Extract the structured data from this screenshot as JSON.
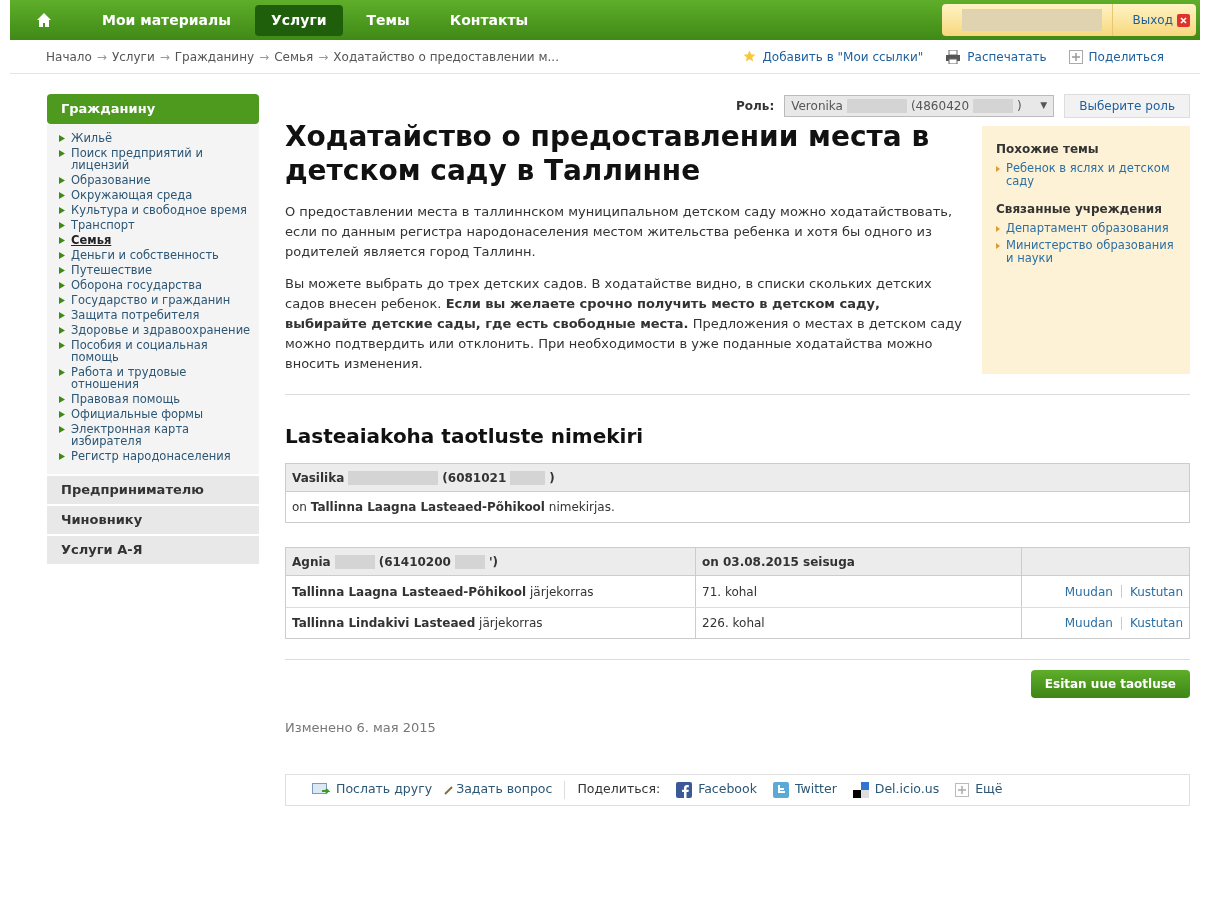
{
  "top_nav": {
    "items": [
      {
        "label": "Мои материалы",
        "selected": false
      },
      {
        "label": "Услуги",
        "selected": true
      },
      {
        "label": "Темы",
        "selected": false
      },
      {
        "label": "Контакты",
        "selected": false
      }
    ],
    "logout": "Выход"
  },
  "breadcrumb": {
    "items": [
      "Начало",
      "Услуги",
      "Гражданину",
      "Семья",
      "Ходатайство о предоставлении м..."
    ],
    "separator": "→",
    "actions": [
      {
        "kind": "star",
        "label": "Добавить в \"Мои ссылки\""
      },
      {
        "kind": "print",
        "label": "Распечатать"
      },
      {
        "kind": "share",
        "label": "Поделиться"
      }
    ]
  },
  "sidebar": {
    "title": "Гражданину",
    "items": [
      {
        "label": "Жильё",
        "selected": false
      },
      {
        "label": "Поиск предприятий и лицензий",
        "selected": false
      },
      {
        "label": "Образование",
        "selected": false
      },
      {
        "label": "Окружающая среда",
        "selected": false
      },
      {
        "label": "Культура и свободное время",
        "selected": false
      },
      {
        "label": "Транспорт",
        "selected": false
      },
      {
        "label": "Семья",
        "selected": true
      },
      {
        "label": "Деньги и собственность",
        "selected": false
      },
      {
        "label": "Путешествие",
        "selected": false
      },
      {
        "label": "Оборона государства",
        "selected": false
      },
      {
        "label": "Государство и гражданин",
        "selected": false
      },
      {
        "label": "Защита потребителя",
        "selected": false
      },
      {
        "label": "Здоровье и здравоохранение",
        "selected": false
      },
      {
        "label": "Пособия и социальная помощь",
        "selected": false
      },
      {
        "label": "Работа и трудовые отношения",
        "selected": false
      },
      {
        "label": "Правовая помощь",
        "selected": false
      },
      {
        "label": "Официальные формы",
        "selected": false
      },
      {
        "label": "Электронная карта избирателя",
        "selected": false
      },
      {
        "label": "Регистр народонаселения",
        "selected": false
      }
    ],
    "sections": [
      "Предпринимателю",
      "Чиновнику",
      "Услуги А-Я"
    ]
  },
  "role": {
    "label": "Роль:",
    "name": "Veronika",
    "id_start": "(4860420",
    "id_end": ")",
    "arrow": "▼",
    "button": "Выберите роль"
  },
  "title": "Ходатайство о предоставлении места в детском саду в Таллинне",
  "paragraphs": [
    "О предоставлении места в таллиннском муниципальном детском саду можно ходатайствовать, если по данным регистра народонаселения местом жительства ребенка и хотя бы одного из родителей является город Таллинн.",
    "Вы можете выбрать до трех детских садов. В ходатайстве видно, в списки скольких детских садов внесен ребенок. **Если вы желаете срочно получить место в детском саду, выбирайте детские сады, где есть свободные места.** Предложения о местах в детском саду можно подтвердить или отклонить. При необходимости в уже поданные ходатайства можно вносить изменения."
  ],
  "related": {
    "topics_title": "Похожие темы",
    "topics": [
      "Ребенок в яслях и детском саду"
    ],
    "institutions_title": "Связанные учреждения",
    "institutions": [
      "Департамент образования",
      "Министерство образования и науки"
    ]
  },
  "applications_title": "Lasteaiakoha taotluste nimekiri",
  "enrolled": {
    "name": "Vasilika",
    "id_start": "(6081021",
    "id_end": ")",
    "text": "on **Tallinna Laagna Lasteaed-Põhikool** nimekirjas."
  },
  "queue": {
    "name": "Agnia",
    "id_start": "(61410200",
    "id_end": "')",
    "column_2": "on 03.08.2015 seisuga",
    "rows": [
      {
        "kindergarten": "**Tallinna Laagna Lasteaed-Põhikool** järjekorras",
        "place": "71. kohal",
        "edit": "Muudan",
        "delete": "Kustutan"
      },
      {
        "kindergarten": "**Tallinna Lindakivi Lasteaed** järjekorras",
        "place": "226. kohal",
        "edit": "Muudan",
        "delete": "Kustutan"
      }
    ]
  },
  "new_application_button": "Esitan uue taotluse",
  "modified": "Изменено 6. мая 2015",
  "footer": {
    "send": "Послать другу",
    "ask": "Задать вопрос",
    "share_label": "Поделиться:",
    "links": [
      {
        "kind": "facebook",
        "label": "Facebook"
      },
      {
        "kind": "twitter",
        "label": "Twitter"
      },
      {
        "kind": "delicious",
        "label": "Del.icio.us"
      },
      {
        "kind": "more",
        "label": "Ещё"
      }
    ]
  }
}
